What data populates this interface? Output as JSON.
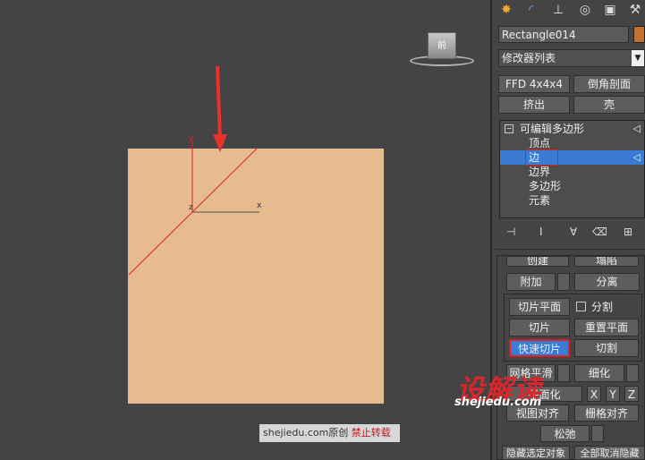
{
  "viewport": {
    "cube_label": "前",
    "axis_y": "y",
    "axis_x": "x",
    "axis_z": "z",
    "watermark_site": "shejiedu.com",
    "watermark_original": "原创",
    "watermark_forbid": "禁止转载",
    "brand_text": "设解读",
    "brand_url": "shejiedu.com",
    "arrow_color": "#e8322c",
    "slice_line_color": "#e02020"
  },
  "panel": {
    "tabs": [
      "sun-icon",
      "curve-icon",
      "hierarchy-icon",
      "motion-icon",
      "display-icon",
      "utility-icon"
    ],
    "object_name": "Rectangle014",
    "object_color": "#c8702a",
    "modifier_list": "修改器列表",
    "buttons_row1": [
      "FFD 4x4x4",
      "倒角剖面"
    ],
    "buttons_row2": [
      "挤出",
      "壳"
    ],
    "stack": {
      "root": "可编辑多边形",
      "items": [
        "顶点",
        "边",
        "边界",
        "多边形",
        "元素"
      ],
      "selected_index": 1
    },
    "top_cut_labels": [
      "创建",
      "塌陷"
    ],
    "attach": "附加",
    "detach": "分离",
    "slice_plane": "切片平面",
    "split": "分割",
    "slice": "切片",
    "reset_plane": "重置平面",
    "quickslice": "快速切片",
    "cut": "切割",
    "meshsmooth": "网格平滑",
    "tessellate": "细化",
    "planarize": "平面化",
    "x": "X",
    "y": "Y",
    "z": "Z",
    "view_align": "视图对齐",
    "grid_align": "栅格对齐",
    "relax": "松弛",
    "hide_selected": "隐藏选定对象",
    "unhide_all": "全部取消隐藏"
  }
}
